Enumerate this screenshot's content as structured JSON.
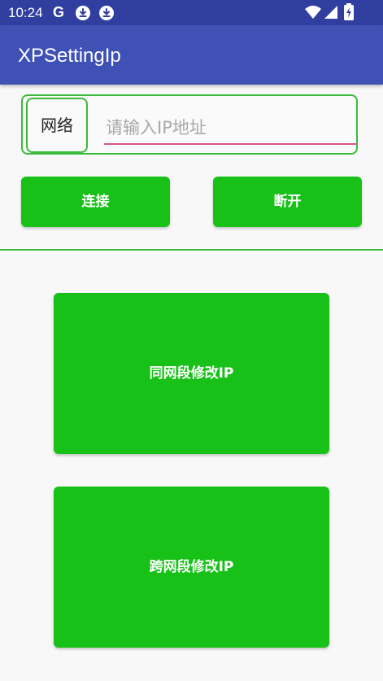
{
  "status_bar": {
    "time": "10:24",
    "g_label": "G",
    "icons": [
      "google-icon",
      "download-icon",
      "download-icon",
      "wifi-icon",
      "signal-icon",
      "battery-charging-icon"
    ]
  },
  "app_bar": {
    "title": "XPSettingIp"
  },
  "network": {
    "label": "网络",
    "ip_input": {
      "value": "",
      "placeholder": "请输入IP地址"
    }
  },
  "buttons": {
    "connect": "连接",
    "disconnect": "断开",
    "same_segment": "同网段修改IP",
    "cross_segment": "跨网段修改IP"
  },
  "colors": {
    "status_bar": "#303f9f",
    "app_bar": "#3f51b5",
    "button": "#18c118",
    "frame_border": "#3cba3c",
    "input_underline": "#d45a8c"
  }
}
